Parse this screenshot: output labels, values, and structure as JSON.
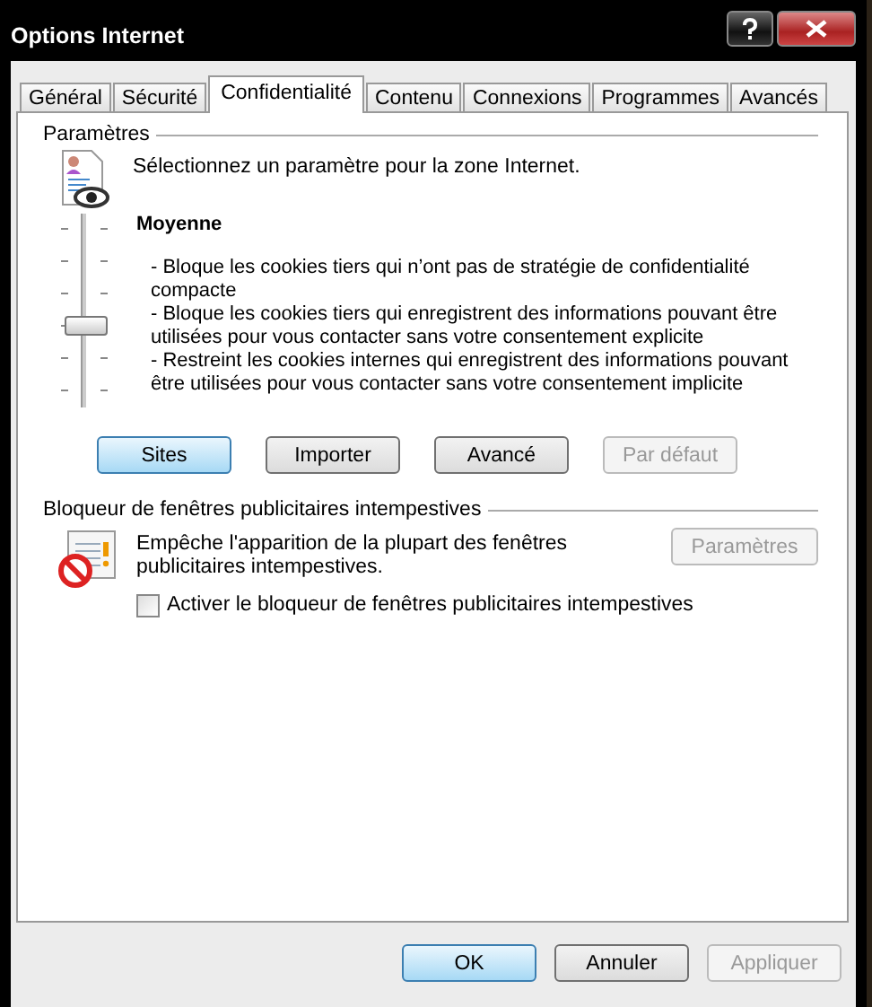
{
  "window": {
    "title": "Options Internet"
  },
  "tabs": [
    {
      "label": "Général",
      "selected": false
    },
    {
      "label": "Sécurité",
      "selected": false
    },
    {
      "label": "Confidentialité",
      "selected": true
    },
    {
      "label": "Contenu",
      "selected": false
    },
    {
      "label": "Connexions",
      "selected": false
    },
    {
      "label": "Programmes",
      "selected": false
    },
    {
      "label": "Avancés",
      "selected": false
    }
  ],
  "settings": {
    "title": "Paramètres",
    "prompt": "Sélectionnez un paramètre pour la zone Internet.",
    "level_name": "Moyenne",
    "slider": {
      "level": 0.4
    },
    "description": [
      "- Bloque les cookies tiers qui n’ont pas de stratégie de confidentialité compacte",
      "- Bloque les cookies tiers qui enregistrent des informations pouvant être utilisées pour vous contacter sans votre consentement explicite",
      "- Restreint les cookies internes qui enregistrent des informations pouvant être utilisées pour vous contacter sans votre consentement implicite"
    ],
    "buttons": [
      {
        "label": "Sites",
        "highlighted": true,
        "disabled": false
      },
      {
        "label": "Importer",
        "highlighted": false,
        "disabled": false
      },
      {
        "label": "Avancé",
        "highlighted": false,
        "disabled": false
      },
      {
        "label": "Par défaut",
        "highlighted": false,
        "disabled": true
      }
    ]
  },
  "popup_blocker": {
    "title": "Bloqueur de fenêtres publicitaires intempestives",
    "description": "Empêche l'apparition de la plupart des fenêtres publicitaires intempestives.",
    "settings_button": {
      "label": "Paramètres",
      "disabled": true
    },
    "checkbox": {
      "label": "Activer le bloqueur de fenêtres publicitaires intempestives",
      "checked": false
    }
  },
  "footer_buttons": [
    {
      "label": "OK",
      "highlighted": true,
      "disabled": false
    },
    {
      "label": "Annuler",
      "highlighted": false,
      "disabled": false
    },
    {
      "label": "Appliquer",
      "highlighted": false,
      "disabled": true
    }
  ]
}
